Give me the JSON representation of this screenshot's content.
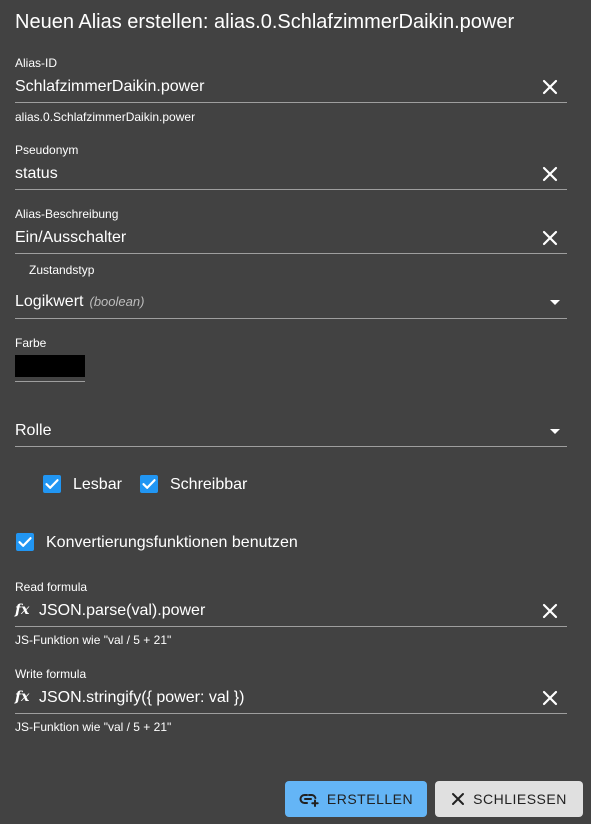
{
  "dialog": {
    "title": "Neuen Alias erstellen: alias.0.SchlafzimmerDaikin.power"
  },
  "alias_id": {
    "label": "Alias-ID",
    "value": "SchlafzimmerDaikin.power",
    "helper": "alias.0.SchlafzimmerDaikin.power"
  },
  "pseudonym": {
    "label": "Pseudonym",
    "value": "status"
  },
  "description": {
    "label": "Alias-Beschreibung",
    "value": "Ein/Ausschalter"
  },
  "state_type": {
    "label": "Zustandstyp",
    "value": "Logikwert",
    "hint": "(boolean)"
  },
  "color": {
    "label": "Farbe",
    "value": "#000000"
  },
  "role": {
    "placeholder": "Rolle"
  },
  "checkboxes": {
    "readable": {
      "label": "Lesbar",
      "checked": true
    },
    "writable": {
      "label": "Schreibbar",
      "checked": true
    },
    "use_conversion": {
      "label": "Konvertierungsfunktionen benutzen",
      "checked": true
    }
  },
  "read_formula": {
    "label": "Read formula",
    "value": "JSON.parse(val).power",
    "helper": "JS-Funktion wie \"val / 5 + 21\""
  },
  "write_formula": {
    "label": "Write formula",
    "value": "JSON.stringify({ power: val })",
    "helper": "JS-Funktion wie \"val / 5 + 21\""
  },
  "actions": {
    "create": "ERSTELLEN",
    "close": "SCHLIESSEN"
  },
  "colors": {
    "background": "#424242",
    "accent": "#2196f3",
    "primary_button": "#64b5f6",
    "secondary_button": "#e0e0e0"
  }
}
